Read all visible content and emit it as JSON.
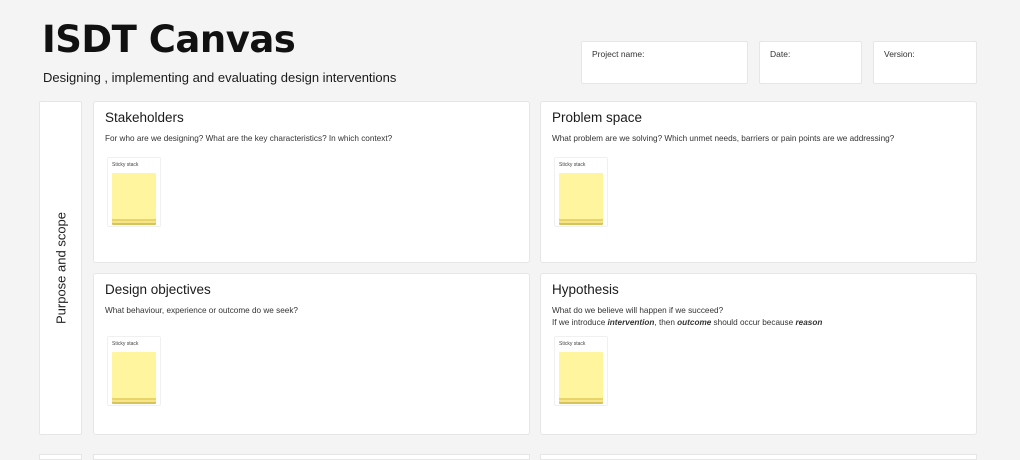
{
  "header": {
    "title": "ISDT Canvas",
    "subtitle": "Designing , implementing and evaluating design interventions"
  },
  "meta_fields": {
    "project_name": "Project name:",
    "date": "Date:",
    "version": "Version:"
  },
  "section_label": "Purpose and scope",
  "sticky_label": "Sticky stack",
  "cards": {
    "stakeholders": {
      "title": "Stakeholders",
      "desc": "For who are we designing? What are the key characteristics? In which context?"
    },
    "problem_space": {
      "title": "Problem space",
      "desc": "What problem are we solving? Which unmet needs, barriers or pain points are we addressing?"
    },
    "design_objectives": {
      "title": "Design objectives",
      "desc": "What behaviour, experience or outcome do we seek?"
    },
    "hypothesis": {
      "title": "Hypothesis",
      "desc_line1": "What do we believe will happen if we succeed?",
      "desc_line2_a": "If we introduce ",
      "desc_line2_b": "intervention",
      "desc_line2_c": ", then ",
      "desc_line2_d": "outcome",
      "desc_line2_e": " should occur because ",
      "desc_line2_f": "reason"
    }
  }
}
